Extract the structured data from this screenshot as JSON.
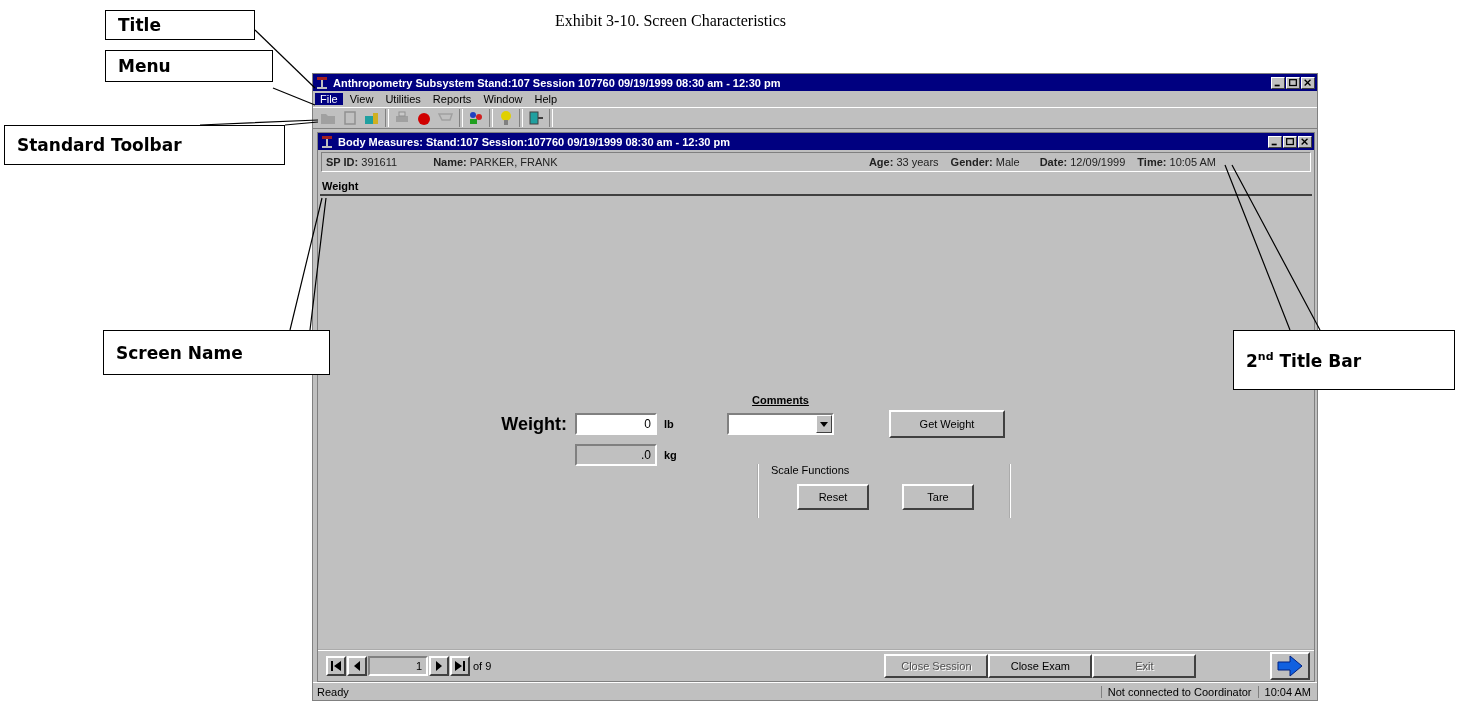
{
  "caption": "Exhibit 3-10. Screen Characteristics",
  "callouts": [
    {
      "label": "Title",
      "kind": "title"
    },
    {
      "label": "Menu",
      "kind": "menu"
    },
    {
      "label": "Standard Toolbar",
      "kind": "toolbar"
    },
    {
      "label": "Screen Name",
      "kind": "screen"
    },
    {
      "label": "2$^{nd}$ Title Bar",
      "kind": "second"
    }
  ],
  "window": {
    "title": "Anthropometry Subsystem  Stand:107 Session 107760 09/19/1999 08:30 am - 12:30 pm"
  },
  "menu": [
    {
      "label": "File",
      "selected": true
    },
    {
      "label": "View",
      "selected": false
    },
    {
      "label": "Utilities",
      "selected": false
    },
    {
      "label": "Reports",
      "selected": false
    },
    {
      "label": "Window",
      "selected": false
    },
    {
      "label": "Help",
      "selected": false
    }
  ],
  "child_window": {
    "title": "Body Measures: Stand:107 Session:107760 09/19/1999 08:30 am - 12:30 pm",
    "info": [
      "**SP ID:** 391611",
      "**Name:** PARKER, FRANK",
      "**Age:** 33 years",
      "**Gender:** Male",
      "**Date:** 12/09/1999",
      "**Time:** 10:05 AM"
    ],
    "screen_name": "Weight",
    "form": {
      "weight_label": "Weight:",
      "lb_value": "0",
      "lb_unit": "lb",
      "kg_value": ".0",
      "kg_unit": "kg",
      "comments_label": "Comments",
      "get_weight": "Get Weight",
      "scale_group": "Scale Functions",
      "reset": "Reset",
      "tare": "Tare"
    },
    "nav": {
      "page": "1",
      "of": "of 9"
    },
    "buttons": [
      {
        "label": "Close Session",
        "disabled": true
      },
      {
        "label": "Close Exam",
        "disabled": false
      },
      {
        "label": "Exit",
        "disabled": true
      }
    ]
  },
  "status_bar": [
    "Ready",
    "Not connected to Coordinator",
    "10:04 AM"
  ]
}
